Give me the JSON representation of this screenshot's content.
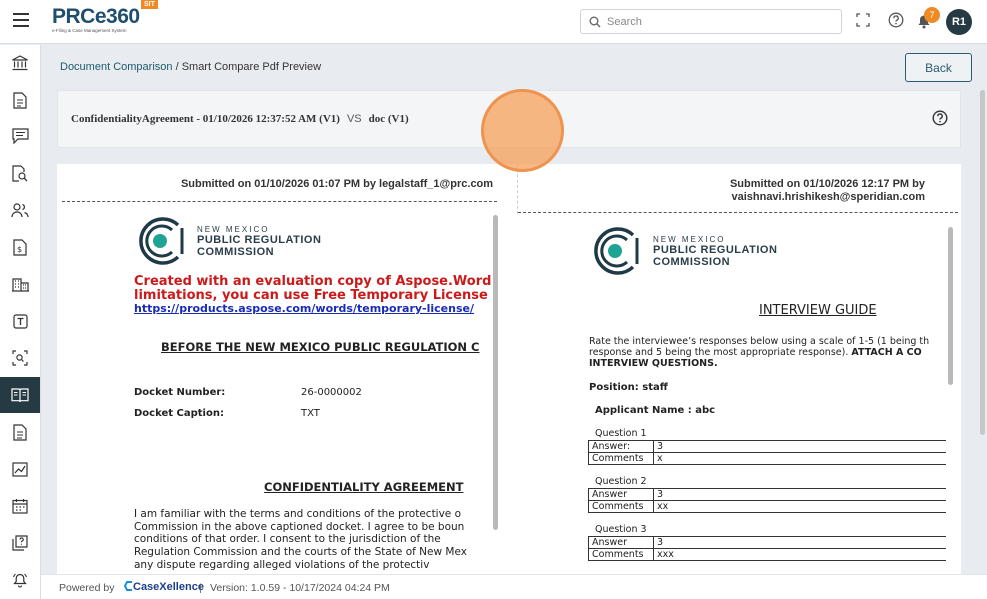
{
  "header": {
    "logo_text": "PRCe360",
    "logo_subtitle": "e-Filing & Case Management System",
    "env_badge": "SIT",
    "search_placeholder": "Search",
    "notification_count": "7",
    "avatar_initials": "R1"
  },
  "breadcrumb": {
    "parent": "Document Comparison",
    "separator": "/",
    "current": "Smart Compare Pdf Preview"
  },
  "back_label": "Back",
  "compare": {
    "left_doc": "ConfidentialityAgreement - 01/10/2026 12:37:52 AM (V1)",
    "vs": "VS",
    "right_doc": "doc (V1)"
  },
  "left_pane": {
    "submitted": "Submitted on 01/10/2026 01:07 PM by legalstaff_1@prc.com",
    "org_line1": "NEW MEXICO",
    "org_line2": "PUBLIC REGULATION",
    "org_line3": "COMMISSION",
    "eval_line1": "Created with an evaluation copy of Aspose.Words. To",
    "eval_line2": "limitations, you can use Free Temporary License",
    "eval_link": "https://products.aspose.com/words/temporary-license/",
    "heading": "BEFORE THE NEW MEXICO PUBLIC REGULATION C",
    "docket_number_label": "Docket Number:",
    "docket_number_value": "26-0000002",
    "docket_caption_label": "Docket Caption:",
    "docket_caption_value": "TXT",
    "section_title": "CONFIDENTIALITY AGREEMENT",
    "para_lines": [
      "I am familiar with the terms and conditions of the protective o",
      "Commission in the above captioned docket. I agree to be boun",
      "conditions of that order. I consent to the jurisdiction of the",
      "Regulation Commission and the courts of the State of New Mex",
      "any dispute regarding alleged violations of the protectiv"
    ]
  },
  "right_pane": {
    "submitted_line1": "Submitted on 01/10/2026 12:17 PM by",
    "submitted_line2": "vaishnavi.hrishikesh@speridian.com",
    "org_line1": "NEW MEXICO",
    "org_line2": "PUBLIC REGULATION",
    "org_line3": "COMMISSION",
    "title": "INTERVIEW GUIDE",
    "intro_line1": "Rate the interviewee’s responses below using a scale of 1-5 (1 being th",
    "intro_line2": "response and 5 being the most appropriate response).",
    "intro_line2_bold": "ATTACH A CO",
    "intro_line3": "INTERVIEW QUESTIONS.",
    "position": "Position: staff",
    "applicant": "Applicant Name : abc",
    "questions": [
      {
        "title": "Question 1",
        "answer_label": "Answer:",
        "answer": "3",
        "comments_label": "Comments",
        "comments": "x"
      },
      {
        "title": "Question 2",
        "answer_label": "Answer",
        "answer": "3",
        "comments_label": "Comments",
        "comments": "xx"
      },
      {
        "title": "Question 3",
        "answer_label": "Answer",
        "answer": "3",
        "comments_label": "Comments",
        "comments": "xxx"
      }
    ]
  },
  "footer": {
    "powered_by": "Powered by",
    "brand": "CaseXellence",
    "separator": "|",
    "version": "Version: 1.0.59 - 10/17/2024 04:24 PM"
  },
  "colors": {
    "accent": "#263a44",
    "badge": "#f08a24",
    "link": "#1f5a6a",
    "eval_red": "#cc1a1a"
  },
  "sidebar_icons": [
    "bank-icon",
    "document-icon",
    "chat-icon",
    "document-search-icon",
    "users-icon",
    "invoice-icon",
    "building-icon",
    "text-box-icon",
    "scan-search-icon",
    "compare-book-icon",
    "file-text-icon",
    "chart-icon",
    "calendar-icon",
    "help-book-icon",
    "bell-alert-icon"
  ]
}
